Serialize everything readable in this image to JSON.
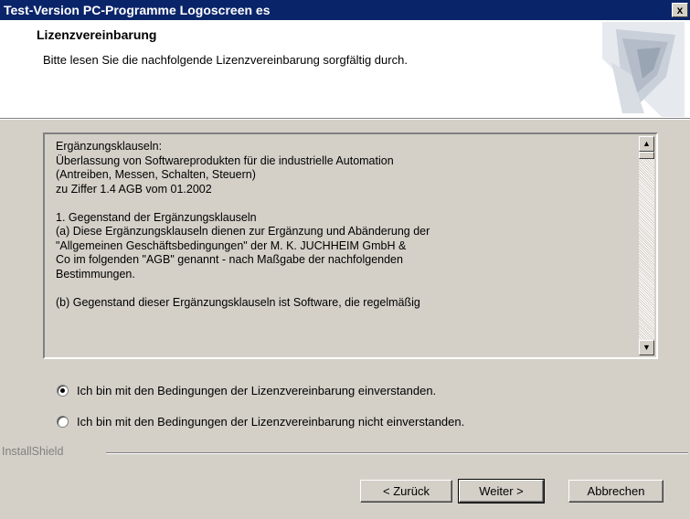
{
  "window": {
    "title": "Test-Version PC-Programme Logoscreen es",
    "close_label": "x"
  },
  "header": {
    "title": "Lizenzvereinbarung",
    "subtitle": "Bitte lesen Sie die nachfolgende Lizenzvereinbarung sorgfältig durch."
  },
  "license": {
    "lines": [
      "Ergänzungsklauseln:",
      "Überlassung von Softwareprodukten für die industrielle Automation",
      "(Antreiben, Messen, Schalten, Steuern)",
      "zu Ziffer 1.4 AGB vom 01.2002",
      "",
      "1. Gegenstand der Ergänzungsklauseln",
      "(a) Diese Ergänzungsklauseln dienen zur Ergänzung und Abänderung der",
      "\"Allgemeinen Geschäftsbedingungen\" der M. K. JUCHHEIM GmbH &",
      "Co im folgenden \"AGB\" genannt - nach Maßgabe der nachfolgenden",
      "Bestimmungen.",
      "",
      "(b) Gegenstand dieser Ergänzungsklauseln ist Software, die regelmäßig"
    ]
  },
  "options": {
    "accept_label": "Ich bin mit den Bedingungen der Lizenzvereinbarung einverstanden.",
    "decline_label": "Ich bin mit den Bedingungen der Lizenzvereinbarung nicht einverstanden.",
    "selected": "accept"
  },
  "footer": {
    "brand": "InstallShield",
    "back_label": "< Zurück",
    "next_label": "Weiter >",
    "cancel_label": "Abbrechen"
  }
}
